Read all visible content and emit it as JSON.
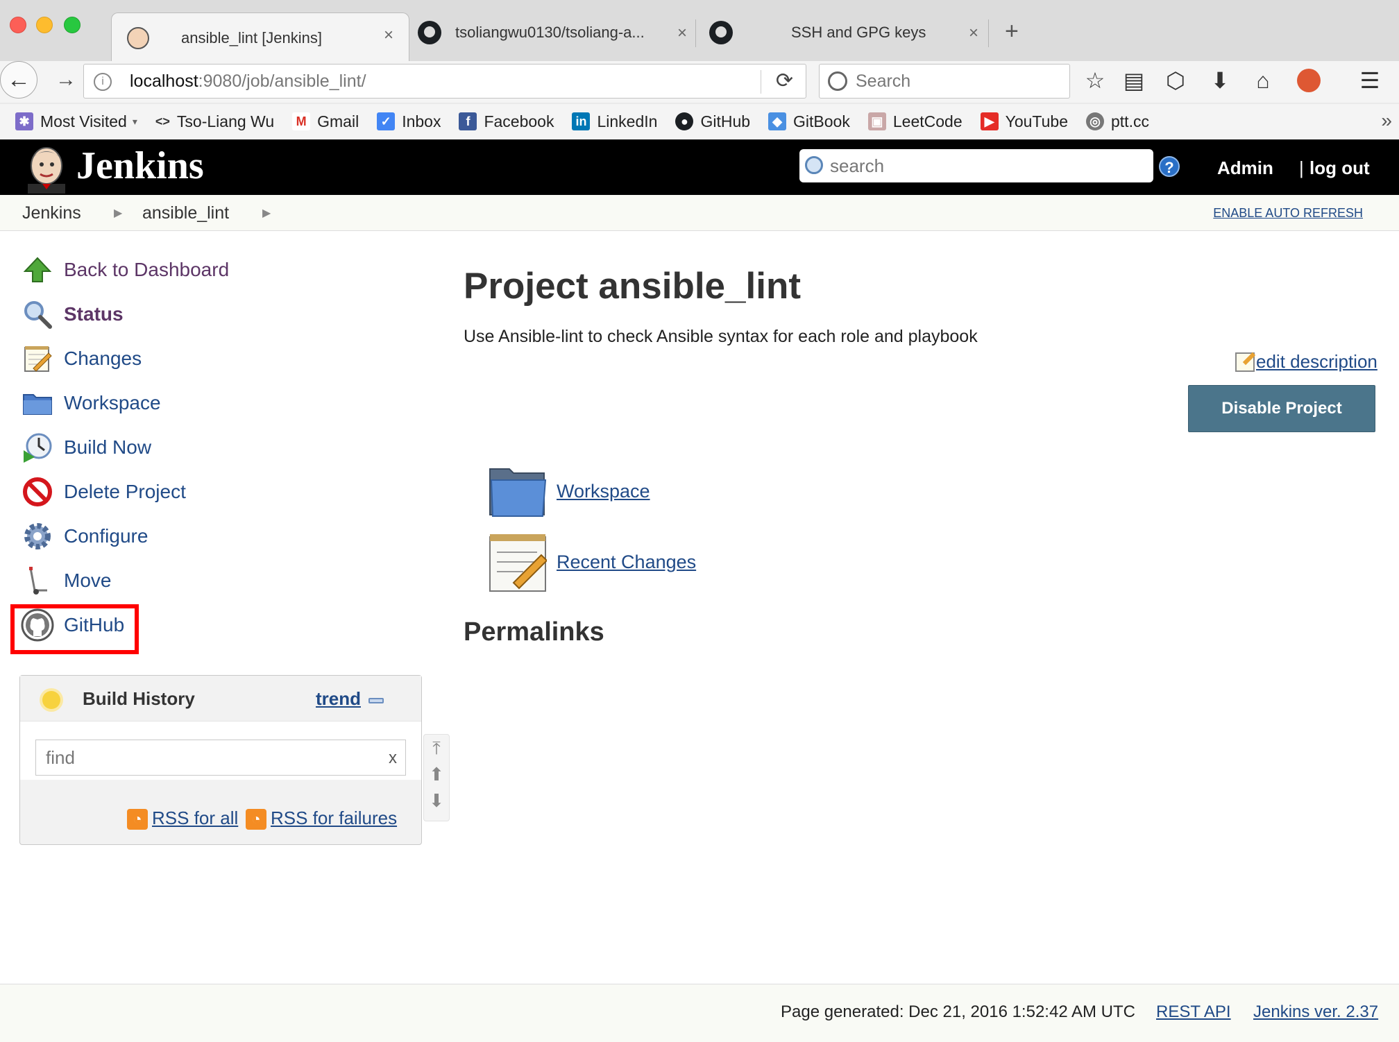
{
  "browser": {
    "tabs": [
      {
        "title": "ansible_lint [Jenkins]",
        "active": true
      },
      {
        "title": "tsoliangwu0130/tsoliang-a...",
        "active": false
      },
      {
        "title": "SSH and GPG keys",
        "active": false
      }
    ],
    "tab_close": "×",
    "new_tab": "+",
    "url_host": "localhost",
    "url_path": ":9080/job/ansible_lint/",
    "search_placeholder": "Search",
    "bookmarks": [
      {
        "label": "Most Visited",
        "icon": "most-visited-icon"
      },
      {
        "label": "Tso-Liang Wu",
        "icon": "code-icon"
      },
      {
        "label": "Gmail",
        "icon": "gmail-icon"
      },
      {
        "label": "Inbox",
        "icon": "inbox-icon"
      },
      {
        "label": "Facebook",
        "icon": "facebook-icon"
      },
      {
        "label": "LinkedIn",
        "icon": "linkedin-icon"
      },
      {
        "label": "GitHub",
        "icon": "github-icon"
      },
      {
        "label": "GitBook",
        "icon": "gitbook-icon"
      },
      {
        "label": "LeetCode",
        "icon": "leetcode-icon"
      },
      {
        "label": "YouTube",
        "icon": "youtube-icon"
      },
      {
        "label": "ptt.cc",
        "icon": "globe-icon"
      }
    ]
  },
  "jenkins": {
    "logo_text": "Jenkins",
    "search_placeholder": "search",
    "help": "?",
    "user": "Admin",
    "separator": "|",
    "logout": "log out"
  },
  "breadcrumbs": {
    "items": [
      "Jenkins",
      "ansible_lint"
    ],
    "auto_refresh": "ENABLE AUTO REFRESH"
  },
  "sidepanel": {
    "tasks": [
      {
        "label": "Back to Dashboard",
        "icon": "up-arrow-icon"
      },
      {
        "label": "Status",
        "icon": "magnifier-icon"
      },
      {
        "label": "Changes",
        "icon": "notepad-icon"
      },
      {
        "label": "Workspace",
        "icon": "folder-icon"
      },
      {
        "label": "Build Now",
        "icon": "clock-icon"
      },
      {
        "label": "Delete Project",
        "icon": "no-entry-icon"
      },
      {
        "label": "Configure",
        "icon": "gear-icon"
      },
      {
        "label": "Move",
        "icon": "hand-truck-icon"
      },
      {
        "label": "GitHub",
        "icon": "github-icon"
      }
    ]
  },
  "build_history": {
    "title": "Build History",
    "trend": "trend",
    "find_placeholder": "find",
    "clear": "x",
    "rss_all": "RSS for all",
    "rss_failures": "RSS for failures"
  },
  "main": {
    "title": "Project ansible_lint",
    "description": "Use Ansible-lint to check Ansible syntax for each role and playbook",
    "edit_description": "edit description",
    "disable_button": "Disable Project",
    "links": [
      {
        "label": "Workspace",
        "icon": "folder-icon"
      },
      {
        "label": "Recent Changes",
        "icon": "notepad-icon"
      }
    ],
    "permalinks": "Permalinks"
  },
  "footer": {
    "generated": "Page generated: Dec 21, 2016 1:52:42 AM UTC",
    "rest_api": "REST API",
    "version": "Jenkins ver. 2.37"
  },
  "colors": {
    "link": "#204a87",
    "visited": "#5c3566",
    "button": "#4b758b",
    "highlight": "#ff0000"
  }
}
